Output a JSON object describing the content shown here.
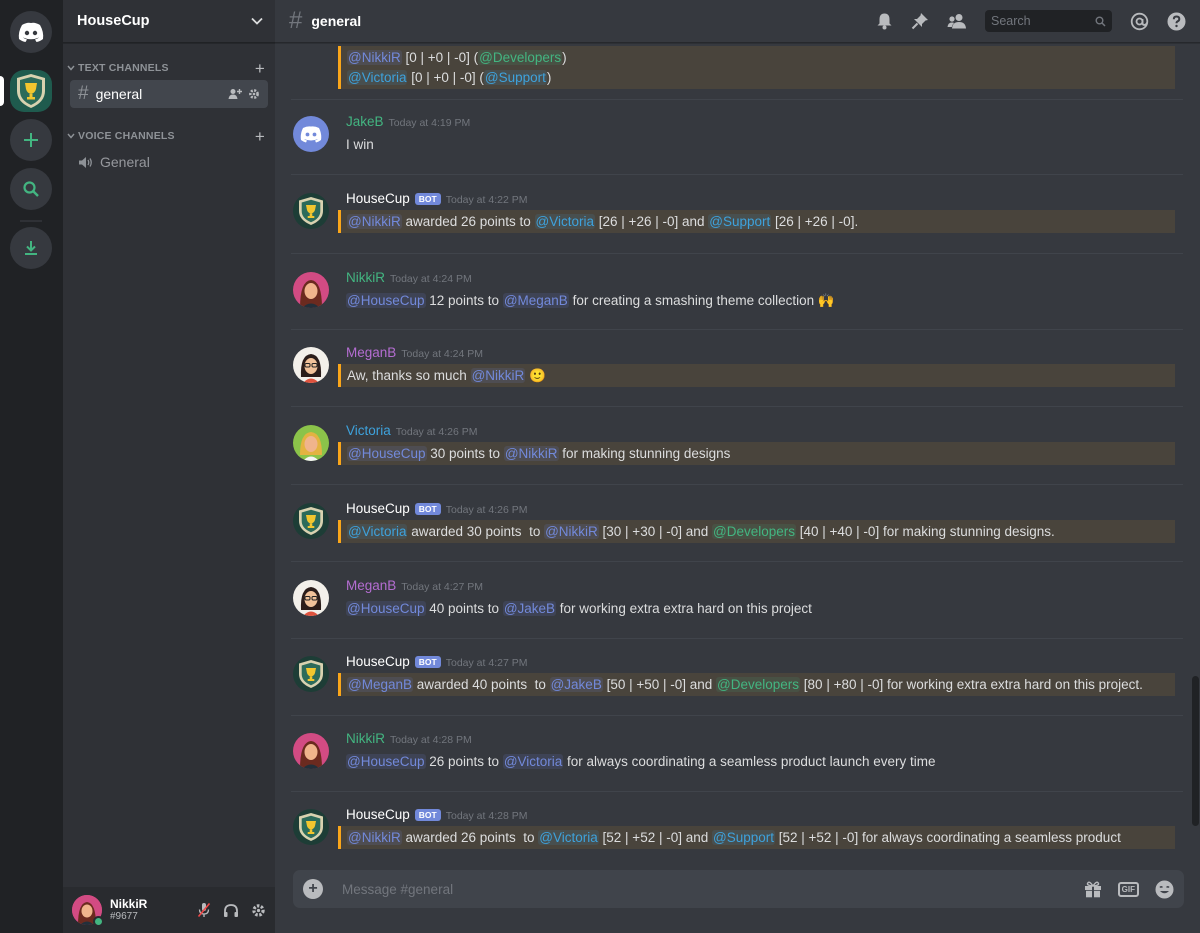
{
  "colors": {
    "mention": "#7289da",
    "role_developers": "#43b581",
    "role_support": "#3ea2dc",
    "highlight_border": "#faa61a",
    "online": "#43b581"
  },
  "server": {
    "name": "HouseCup"
  },
  "sidebar": {
    "text_category": "TEXT CHANNELS",
    "voice_category": "VOICE CHANNELS",
    "text_channels": [
      {
        "name": "general"
      }
    ],
    "voice_channels": [
      {
        "name": "General"
      }
    ]
  },
  "user": {
    "name": "NikkiR",
    "tag": "#9677"
  },
  "header": {
    "channel": "general",
    "search_placeholder": "Search"
  },
  "composer": {
    "placeholder": "Message #general"
  },
  "messages": [
    {
      "continued": true,
      "lines": [
        {
          "hl": true,
          "parts": [
            {
              "t": "@NikkiR",
              "m": "u"
            },
            {
              "t": " [0 | +0 | -0] ("
            },
            {
              "t": "@Developers",
              "m": "g"
            },
            {
              "t": ")"
            }
          ]
        },
        {
          "hl": true,
          "parts": [
            {
              "t": "@Victoria",
              "m": "b"
            },
            {
              "t": " [0 | +0 | -0] ("
            },
            {
              "t": "@Support",
              "m": "b"
            },
            {
              "t": ")"
            }
          ]
        }
      ]
    },
    {
      "author": "JakeB",
      "color": "#43b581",
      "time": "Today at 4:19 PM",
      "avatar": "discord",
      "lines": [
        {
          "hl": false,
          "parts": [
            {
              "t": "I win"
            }
          ]
        }
      ]
    },
    {
      "author": "HouseCup",
      "color": "#ffffff",
      "bot": "BOT",
      "time": "Today at 4:22 PM",
      "avatar": "shield",
      "lines": [
        {
          "hl": true,
          "parts": [
            {
              "t": "@NikkiR",
              "m": "u"
            },
            {
              "t": " awarded 26 points to "
            },
            {
              "t": "@Victoria",
              "m": "b"
            },
            {
              "t": " [26 | +26 | -0] and "
            },
            {
              "t": "@Support",
              "m": "b"
            },
            {
              "t": " [26 | +26 | -0]."
            }
          ]
        }
      ]
    },
    {
      "author": "NikkiR",
      "color": "#43b581",
      "time": "Today at 4:24 PM",
      "avatar": "nikki",
      "lines": [
        {
          "hl": false,
          "parts": [
            {
              "t": "@HouseCup",
              "m": "u"
            },
            {
              "t": " 12 points to "
            },
            {
              "t": "@MeganB",
              "m": "u"
            },
            {
              "t": " for creating a smashing theme collection 🙌"
            }
          ]
        }
      ]
    },
    {
      "author": "MeganB",
      "color": "#b46dd1",
      "time": "Today at 4:24 PM",
      "avatar": "megan",
      "lines": [
        {
          "hl": true,
          "parts": [
            {
              "t": "Aw, thanks so much "
            },
            {
              "t": "@NikkiR",
              "m": "u"
            },
            {
              "t": " 🙂"
            }
          ]
        }
      ]
    },
    {
      "author": "Victoria",
      "color": "#3ea2dc",
      "time": "Today at 4:26 PM",
      "avatar": "victoria",
      "lines": [
        {
          "hl": true,
          "parts": [
            {
              "t": "@HouseCup",
              "m": "u"
            },
            {
              "t": " 30 points to "
            },
            {
              "t": "@NikkiR",
              "m": "u"
            },
            {
              "t": " for making stunning designs"
            }
          ]
        }
      ]
    },
    {
      "author": "HouseCup",
      "color": "#ffffff",
      "bot": "BOT",
      "time": "Today at 4:26 PM",
      "avatar": "shield",
      "lines": [
        {
          "hl": true,
          "parts": [
            {
              "t": "@Victoria",
              "m": "b"
            },
            {
              "t": " awarded 30 points  to "
            },
            {
              "t": "@NikkiR",
              "m": "u"
            },
            {
              "t": " [30 | +30 | -0] and "
            },
            {
              "t": "@Developers",
              "m": "g"
            },
            {
              "t": " [40 | +40 | -0] for making stunning designs."
            }
          ]
        }
      ]
    },
    {
      "author": "MeganB",
      "color": "#b46dd1",
      "time": "Today at 4:27 PM",
      "avatar": "megan",
      "lines": [
        {
          "hl": false,
          "parts": [
            {
              "t": "@HouseCup",
              "m": "u"
            },
            {
              "t": " 40 points to "
            },
            {
              "t": "@JakeB",
              "m": "u"
            },
            {
              "t": " for working extra extra hard on this project"
            }
          ]
        }
      ]
    },
    {
      "author": "HouseCup",
      "color": "#ffffff",
      "bot": "BOT",
      "time": "Today at 4:27 PM",
      "avatar": "shield",
      "lines": [
        {
          "hl": true,
          "parts": [
            {
              "t": "@MeganB",
              "m": "u"
            },
            {
              "t": " awarded 40 points  to "
            },
            {
              "t": "@JakeB",
              "m": "u"
            },
            {
              "t": " [50 | +50 | -0] and "
            },
            {
              "t": "@Developers",
              "m": "g"
            },
            {
              "t": " [80 | +80 | -0] for working extra extra hard on this project."
            }
          ]
        }
      ]
    },
    {
      "author": "NikkiR",
      "color": "#43b581",
      "time": "Today at 4:28 PM",
      "avatar": "nikki",
      "lines": [
        {
          "hl": false,
          "parts": [
            {
              "t": "@HouseCup",
              "m": "u"
            },
            {
              "t": " 26 points to "
            },
            {
              "t": "@Victoria",
              "m": "u"
            },
            {
              "t": " for always coordinating a seamless product launch every time"
            }
          ]
        }
      ]
    },
    {
      "author": "HouseCup",
      "color": "#ffffff",
      "bot": "BOT",
      "time": "Today at 4:28 PM",
      "avatar": "shield",
      "lines": [
        {
          "hl": true,
          "parts": [
            {
              "t": "@NikkiR",
              "m": "u"
            },
            {
              "t": " awarded 26 points  to "
            },
            {
              "t": "@Victoria",
              "m": "b"
            },
            {
              "t": " [52 | +52 | -0] and "
            },
            {
              "t": "@Support",
              "m": "b"
            },
            {
              "t": " [52 | +52 | -0] for always coordinating a seamless product"
            }
          ]
        }
      ]
    }
  ]
}
